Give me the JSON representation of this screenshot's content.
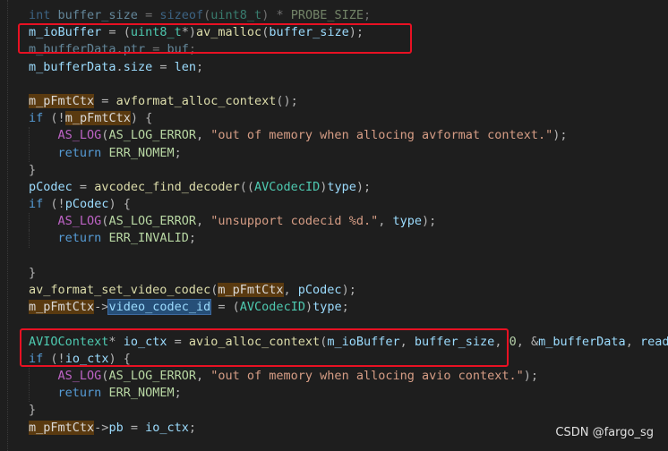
{
  "colors": {
    "background": "#1e1e1e",
    "annotation_box": "#e81123"
  },
  "editor": {
    "lines": [
      {
        "text": "int buffer_size = sizeof(uint8_t) * PROBE_SIZE;",
        "dim": true
      },
      {
        "text": "m_ioBuffer = (uint8_t*)av_malloc(buffer_size);"
      },
      {
        "text": "m_bufferData.ptr = buf;",
        "dim": true
      },
      {
        "text": "m_bufferData.size = len;"
      },
      {
        "text": ""
      },
      {
        "text": "m_pFmtCtx = avformat_alloc_context();"
      },
      {
        "text": "if (!m_pFmtCtx) {"
      },
      {
        "text": "    AS_LOG(AS_LOG_ERROR, \"out of memory when allocing avformat context.\");"
      },
      {
        "text": "    return ERR_NOMEM;"
      },
      {
        "text": "}"
      },
      {
        "text": "pCodec = avcodec_find_decoder((AVCodecID)type);"
      },
      {
        "text": "if (!pCodec) {"
      },
      {
        "text": "    AS_LOG(AS_LOG_ERROR, \"unsupport codecid %d.\", type);"
      },
      {
        "text": "    return ERR_INVALID;"
      },
      {
        "text": ""
      },
      {
        "text": "}"
      },
      {
        "text": "av_format_set_video_codec(m_pFmtCtx, pCodec);"
      },
      {
        "text": "m_pFmtCtx->video_codec_id = (AVCodecID)type;"
      },
      {
        "text": ""
      },
      {
        "text": "AVIOContext* io_ctx = avio_alloc_context(m_ioBuffer, buffer_size, 0, &m_bufferData, read_data, NULL, NULL);"
      },
      {
        "text": "if (!io_ctx) {"
      },
      {
        "text": "    AS_LOG(AS_LOG_ERROR, \"out of memory when allocing avio context.\");"
      },
      {
        "text": "    return ERR_NOMEM;"
      },
      {
        "text": "}"
      },
      {
        "text": "m_pFmtCtx->pb = io_ctx;"
      }
    ]
  },
  "annotations": [
    {
      "name": "highlight-box-av-malloc",
      "label": ""
    },
    {
      "name": "highlight-box-avio-alloc-context",
      "label": ""
    }
  ],
  "watermark": "CSDN @fargo_sg"
}
